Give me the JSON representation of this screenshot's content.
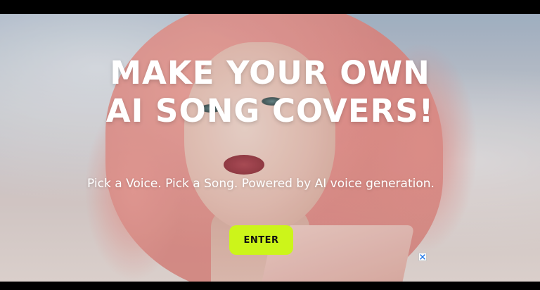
{
  "hero": {
    "headline_line1": "MAKE YOUR OWN",
    "headline_line2": "AI SONG COVERS!",
    "subheadline": "Pick a Voice. Pick a Song. Powered by AI voice generation.",
    "image_description_icon": "portrait-photo"
  },
  "cta": {
    "enter_label": "ENTER",
    "color": "#ccf51a"
  },
  "ad": {
    "close_icon": "close-icon",
    "close_color": "#1a73e8"
  }
}
